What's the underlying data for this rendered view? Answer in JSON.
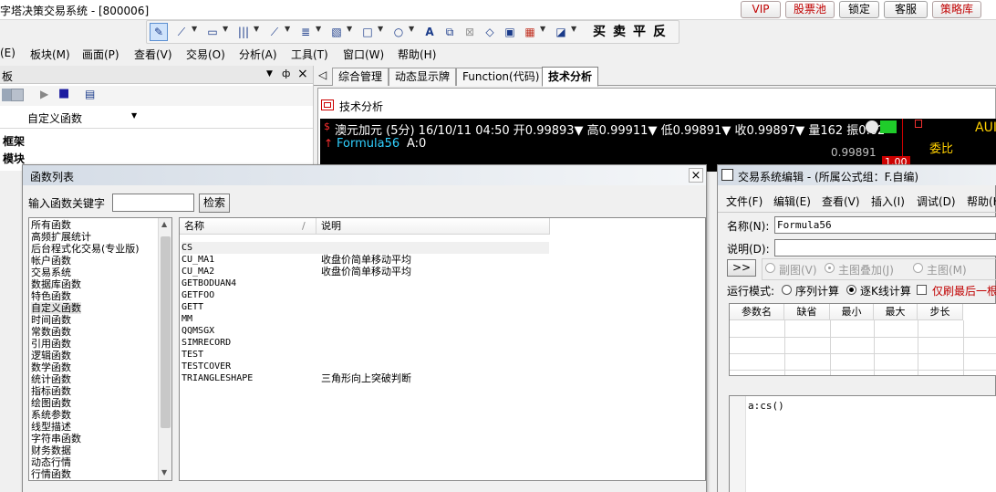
{
  "app": {
    "title": "字塔决策交易系统 - [800006]",
    "top_buttons": [
      "VIP",
      "股票池",
      "锁定",
      "客服",
      "策略库"
    ]
  },
  "toolbar": {
    "trade": [
      "买",
      "卖",
      "平",
      "反"
    ]
  },
  "menu": [
    "(E)",
    "板块(M)",
    "画面(P)",
    "查看(V)",
    "交易(O)",
    "分析(A)",
    "工具(T)",
    "窗口(W)",
    "帮助(H)"
  ],
  "left_panel": {
    "title": "板",
    "close": "×",
    "pin": "ф",
    "dropdown": "▼",
    "select_value": "自定义函数",
    "tree": [
      "框架",
      "模块"
    ]
  },
  "tabs": [
    "综合管理",
    "动态显示牌",
    "Function(代码)",
    "技术分析"
  ],
  "tab_scroll": "◁",
  "chart": {
    "window_title": "技术分析",
    "info": "澳元加元 (5分) 16/10/11 04:50 开0.99893▼ 高0.99911▼ 低0.99891▼ 收0.99897▼ 量162 振0.02",
    "formula": "Formula56",
    "formula_value": "A:0",
    "price_label": "0.99891",
    "side_label": "AUI",
    "side_label2": "委比",
    "marker_value": "1.00"
  },
  "func_window": {
    "title": "函数列表",
    "close": "×",
    "search_label": "输入函数关键字",
    "search_value": "",
    "search_button": "检索",
    "categories": [
      "所有函数",
      "高频扩展统计",
      "后台程式化交易(专业版)",
      "帐户函数",
      "交易系统",
      "数据库函数",
      "特色函数",
      "自定义函数",
      "时间函数",
      "常数函数",
      "引用函数",
      "逻辑函数",
      "数学函数",
      "统计函数",
      "指标函数",
      "绘图函数",
      "系统参数",
      "线型描述",
      "字符串函数",
      "财务数据",
      "动态行情",
      "行情函数"
    ],
    "selected_category": "自定义函数",
    "columns": [
      "名称",
      "/",
      "说明"
    ],
    "rows": [
      {
        "name": "CS",
        "desc": ""
      },
      {
        "name": "CU_MA1",
        "desc": "收盘价简单移动平均"
      },
      {
        "name": "CU_MA2",
        "desc": "收盘价简单移动平均"
      },
      {
        "name": "GETBODUAN4",
        "desc": ""
      },
      {
        "name": "GETFOO",
        "desc": ""
      },
      {
        "name": "GETT",
        "desc": ""
      },
      {
        "name": "MM",
        "desc": ""
      },
      {
        "name": "QQMSGX",
        "desc": ""
      },
      {
        "name": "SIMRECORD",
        "desc": ""
      },
      {
        "name": "TEST",
        "desc": ""
      },
      {
        "name": "TESTCOVER",
        "desc": ""
      },
      {
        "name": "TRIANGLESHAPE",
        "desc": "三角形向上突破判断"
      }
    ]
  },
  "edit_window": {
    "title": "交易系统编辑 - (所属公式组：F.自编)",
    "menu": [
      "文件(F)",
      "编辑(E)",
      "查看(V)",
      "插入(I)",
      "调试(D)",
      "帮助(H)"
    ],
    "name_label": "名称(N):",
    "name_value": "Formula56",
    "desc_label": "说明(D):",
    "desc_value": "",
    "expand_btn": ">>",
    "radios1": [
      "副图(V)",
      "主图叠加(J)",
      "主图(M)"
    ],
    "run_mode_label": "运行模式:",
    "run_modes": [
      "序列计算",
      "逐K线计算"
    ],
    "refresh_label": "仅刷最后一根",
    "param_columns": [
      "参数名",
      "缺省",
      "最小",
      "最大",
      "步长"
    ],
    "code": "a:cs()"
  }
}
